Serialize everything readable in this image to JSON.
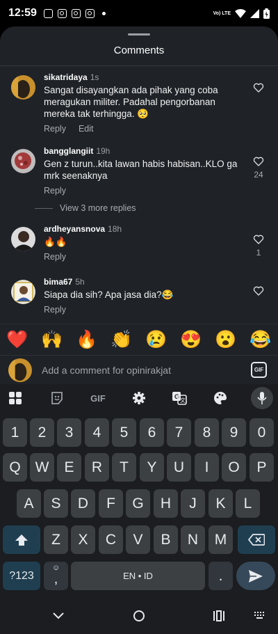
{
  "status_bar": {
    "time": "12:59",
    "network_label": "Vo) LTE"
  },
  "sheet": {
    "title": "Comments"
  },
  "comments": [
    {
      "username": "sikatridaya",
      "time": "1s",
      "text": "Sangat disayangkan ada pihak yang coba meragukan militer. Padahal pengorbanan mereka tak terhingga. 🥺",
      "reply": "Reply",
      "edit": "Edit",
      "likes": ""
    },
    {
      "username": "bangglangiit",
      "time": "19h",
      "text": "Gen z turun..kita lawan habis habisan..KLO ga mrk seenaknya",
      "reply": "Reply",
      "likes": "24",
      "more_replies": "View 3 more replies"
    },
    {
      "username": "ardheyansnova",
      "time": "18h",
      "text": "🔥🔥",
      "reply": "Reply",
      "likes": "1"
    },
    {
      "username": "bima67",
      "time": "5h",
      "text": "Siapa dia sih? Apa jasa dia?😂",
      "reply": "Reply",
      "likes": ""
    }
  ],
  "emoji_bar": [
    "❤️",
    "🙌",
    "🔥",
    "👏",
    "😢",
    "😍",
    "😮",
    "😂"
  ],
  "composer": {
    "placeholder": "Add a comment for opinirakjat",
    "gif_label": "GIF"
  },
  "keyboard": {
    "toolbar_gif": "GIF",
    "row_numbers": [
      "1",
      "2",
      "3",
      "4",
      "5",
      "6",
      "7",
      "8",
      "9",
      "0"
    ],
    "row_q": [
      "Q",
      "W",
      "E",
      "R",
      "T",
      "Y",
      "U",
      "I",
      "O",
      "P"
    ],
    "row_a": [
      "A",
      "S",
      "D",
      "F",
      "G",
      "H",
      "J",
      "K",
      "L"
    ],
    "row_z": [
      "Z",
      "X",
      "C",
      "V",
      "B",
      "N",
      "M"
    ],
    "symbols": "?123",
    "comma": ",",
    "space": "EN • ID",
    "period": "."
  },
  "colors": {
    "sheet_bg": "#1f2328",
    "keyboard_bg": "#1b1d20",
    "key_bg": "#3c4043",
    "accent_key": "#1f3f51"
  },
  "icons": [
    "heart-icon",
    "grid-icon",
    "sticker-icon",
    "settings-gear-icon",
    "translate-icon",
    "palette-icon",
    "mic-icon",
    "shift-icon",
    "backspace-icon",
    "send-icon",
    "nav-back-icon",
    "nav-home-icon",
    "nav-recents-icon",
    "keyboard-switch-icon"
  ]
}
